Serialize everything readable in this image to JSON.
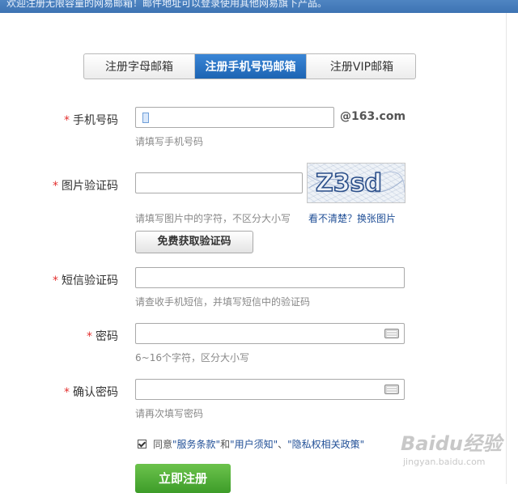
{
  "header": {
    "notice": "欢迎注册无限容量的网易邮箱！邮件地址可以登录使用其他网易旗下产品。"
  },
  "tabs": [
    {
      "label": "注册字母邮箱"
    },
    {
      "label": "注册手机号码邮箱"
    },
    {
      "label": "注册VIP邮箱"
    }
  ],
  "form": {
    "required_mark": "*",
    "phone": {
      "label": "手机号码",
      "value": "",
      "suffix": "@163.com",
      "hint": "请填写手机号码"
    },
    "captcha": {
      "label": "图片验证码",
      "value": "",
      "hint": "请填写图片中的字符，不区分大小写",
      "image_text": "Z3sd",
      "refresh": "看不清楚？换张图片"
    },
    "get_code_button": "免费获取验证码",
    "sms": {
      "label": "短信验证码",
      "value": "",
      "hint": "请查收手机短信，并填写短信中的验证码"
    },
    "password": {
      "label": "密码",
      "value": "",
      "hint": "6~16个字符，区分大小写"
    },
    "confirm": {
      "label": "确认密码",
      "value": "",
      "hint": "请再次填写密码"
    },
    "agreement": {
      "checked": true,
      "prefix": "同意",
      "link1": "\"服务条款\"",
      "and": "和",
      "link2": "\"用户须知\"",
      "sep": "、",
      "link3": "\"隐私权相关政策\""
    },
    "submit": "立即注册"
  },
  "watermark": {
    "brand": "Baidu经验",
    "url": "jingyan.baidu.com"
  },
  "colors": {
    "tab_active": "#1c64b3",
    "required": "#e3302f",
    "submit": "#3d9c29",
    "link": "#1f4e96"
  }
}
